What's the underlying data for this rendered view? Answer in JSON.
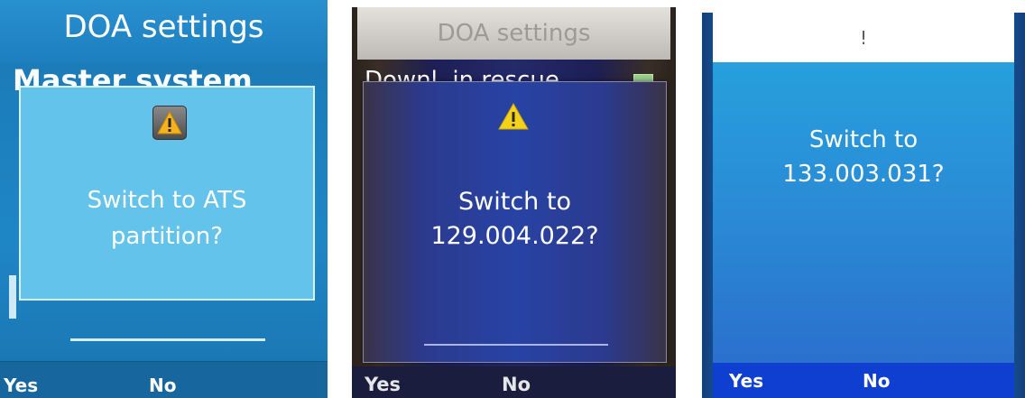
{
  "panels": [
    {
      "title": "DOA settings",
      "menu_row": "Master system",
      "icon": "warning-icon",
      "message_line1": "Switch to ATS",
      "message_line2": "partition?",
      "softkey_left": "Yes",
      "softkey_right": "No"
    },
    {
      "title": "DOA settings",
      "menu_row": "Downl. in rescue",
      "icon": "warning-icon",
      "message_line1": "Switch to",
      "message_line2": "129.004.022?",
      "softkey_left": "Yes",
      "softkey_right": "No"
    },
    {
      "title": "!",
      "message_line1": "Switch to",
      "message_line2": "133.003.031?",
      "softkey_left": "Yes",
      "softkey_right": "No"
    }
  ],
  "colors": {
    "panel1_dialog": "#64c3ea",
    "panel2_dialog": "#2743a4",
    "panel3_body": "#2a8ad6",
    "warning_yellow": "#f6b21d"
  }
}
